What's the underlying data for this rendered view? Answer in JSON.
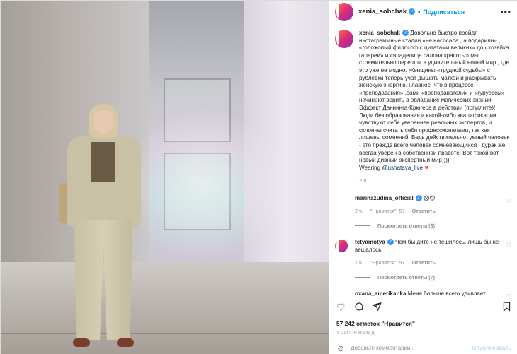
{
  "post": {
    "author": "xenia_sobchak",
    "follow_label": "Подписаться",
    "header_separator": "•",
    "caption": "Довольно быстро пройдя инстаграммные стадии «не насосала , а подарили» , «голожопый философ с цитатами великих» до «хозяйка галереи» и «владелица салона красоты» мы стремительно перешли в удивительный новый мир , где это уже не модно. Женщины «трудной судьбы» с рублевки теперь учат дышать маткой и раскрывать женскую энергию. Главное ,что в процессе «преподавания» ,сами «преподаватели» и «гуруессы» начинают верить в обладание магических знаний.\nЭффект Даннинга-Крюгера в действии (погуглите)!!\nЛюди без образования и какой-либо квалификации чувствуют себя увереннее реальных экспертов, и склонны считать себя профессионалами, так как лишены сомнений. Ведь действительно, умный человек - это прежде всего человек сомневающийся , дурак же всегда уверен в собственной правоте. Вот такой вот новый дивный экспертный мир))))\nWearing ",
    "caption_mention": "@ushatava_live",
    "caption_heart": "❤",
    "caption_time": "2 ч."
  },
  "comments": [
    {
      "user": "marinazudina_official",
      "text": "",
      "emoji": "😱😊",
      "time": "2 ч.",
      "likes": "\"Нравится\": 57",
      "reply_label": "Ответить",
      "view_replies": "Посмотреть ответы (3)"
    },
    {
      "user": "tetyamotya",
      "text": "Чем бы дитё не тешилось, лишь бы не вешалось!",
      "emoji": "",
      "time": "1 ч.",
      "likes": "\"Нравится\": 97",
      "reply_label": "Ответить",
      "view_replies": "Посмотреть ответы (7)"
    },
    {
      "user": "oxana_amerikanka",
      "text": "Меня больше всего удивляет сколько стало специалистов по марафонам желаний и позитивному мышлению)) марафон на марафоне о том как наметчать себе восхитительную жизнь",
      "emoji": "",
      "time": "",
      "likes": "",
      "reply_label": "",
      "view_replies": ""
    }
  ],
  "actions": {
    "likes_text": "57 242 отметок \"Нравится\"",
    "time_ago": "2 ЧАСОВ НАЗАД",
    "icons": [
      "heart-icon",
      "comment-icon",
      "share-icon",
      "bookmark-icon"
    ]
  },
  "add_comment": {
    "placeholder": "Добавьте комментарий...",
    "publish_label": "Опубликовать"
  },
  "colors": {
    "link_blue": "#0095f6",
    "verified_blue": "#3897f0",
    "muted_grey": "#8e8e8e",
    "heart_red": "#ed4956"
  }
}
